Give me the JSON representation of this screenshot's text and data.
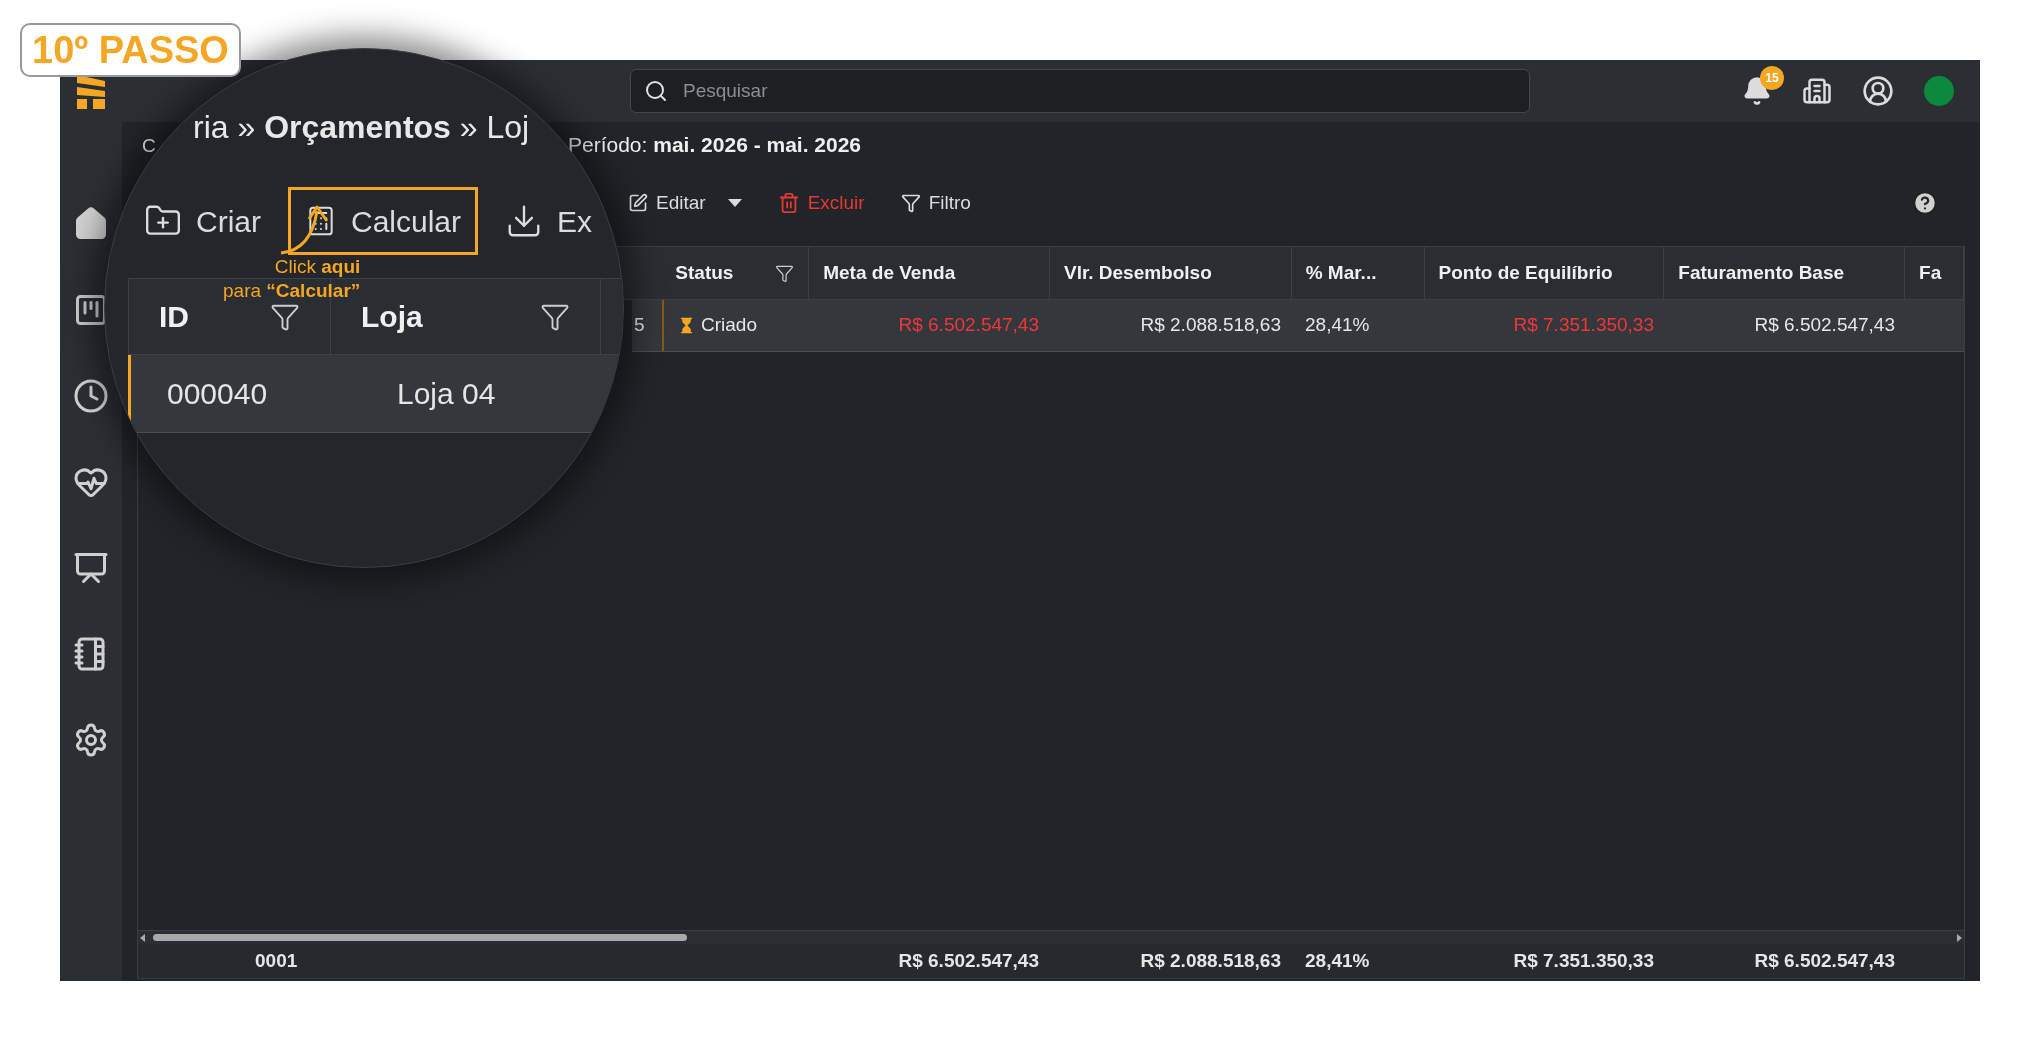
{
  "badge": "10º PASSO",
  "search": {
    "placeholder": "Pesquisar"
  },
  "notifications": {
    "count": "15"
  },
  "breadcrumb_fragment": "C",
  "period": {
    "label": "Período:",
    "value": "mai. 2026 - mai. 2026"
  },
  "toolbar": [
    {
      "label": "Editar",
      "kind": "edit"
    },
    {
      "label": "Excluir",
      "kind": "delete"
    },
    {
      "label": "Filtro",
      "kind": "filter"
    }
  ],
  "table": {
    "columns": [
      {
        "label": "Status",
        "filter": true
      },
      {
        "label": "Meta de Venda",
        "filter": false
      },
      {
        "label": "Vlr. Desembolso",
        "filter": false
      },
      {
        "label": "% Mar...",
        "filter": false
      },
      {
        "label": "Ponto de Equilíbrio",
        "filter": false
      },
      {
        "label": "Faturamento Base",
        "filter": false
      },
      {
        "label": "Fa",
        "filter": false
      }
    ],
    "rows": [
      {
        "selected": true,
        "column_3": "5",
        "cells": [
          {
            "text": "Criado",
            "kind": "status"
          },
          {
            "text": "R$ 6.502.547,43",
            "kind": "negative"
          },
          {
            "text": "R$ 2.088.518,63",
            "kind": "money"
          },
          {
            "text": "28,41%",
            "kind": "percent"
          },
          {
            "text": "R$ 7.351.350,33",
            "kind": "negative"
          },
          {
            "text": "R$ 6.502.547,43",
            "kind": "money"
          }
        ]
      }
    ],
    "footer": {
      "count": "0001",
      "totals": [
        "R$ 6.502.547,43",
        "R$ 2.088.518,63",
        "28,41%",
        "R$ 7.351.350,33",
        "R$ 6.502.547,43"
      ]
    }
  },
  "magnifier": {
    "breadcrumb": "ria » **Orçamentos** » Loj",
    "toolbar": [
      {
        "label": "Criar",
        "kind": "create",
        "highlighted": false
      },
      {
        "label": "Calcular",
        "kind": "calculate",
        "highlighted": true
      },
      {
        "label": "Ex",
        "kind": "export",
        "highlighted": false
      }
    ],
    "columns": [
      "ID",
      "Loja"
    ],
    "row": {
      "selected": true,
      "cells": [
        "000040",
        "Loja 04"
      ]
    },
    "callout": [
      "Click **aqui**",
      "para **“Calcular”**"
    ]
  }
}
